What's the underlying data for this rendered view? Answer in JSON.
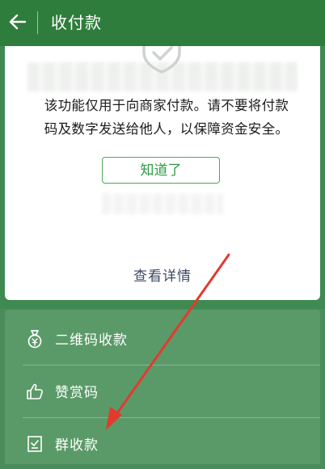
{
  "header": {
    "title": "收付款",
    "back_icon": "arrow-left-icon"
  },
  "card": {
    "notice_line1": "该功能仅用于向商家付款。请不要将付款",
    "notice_line2": "码及数字发送给他人，以保障资金安全。",
    "ok_label": "知道了",
    "detail_label": "查看详情"
  },
  "menu": {
    "items": [
      {
        "label": "二维码收款",
        "icon": "money-bag-icon"
      },
      {
        "label": "赞赏码",
        "icon": "thumbs-up-icon"
      },
      {
        "label": "群收款",
        "icon": "group-receipt-icon"
      }
    ]
  },
  "colors": {
    "topbar": "#2f7d3c",
    "accent": "#2e9b44",
    "annotation": "#e23a2e"
  }
}
